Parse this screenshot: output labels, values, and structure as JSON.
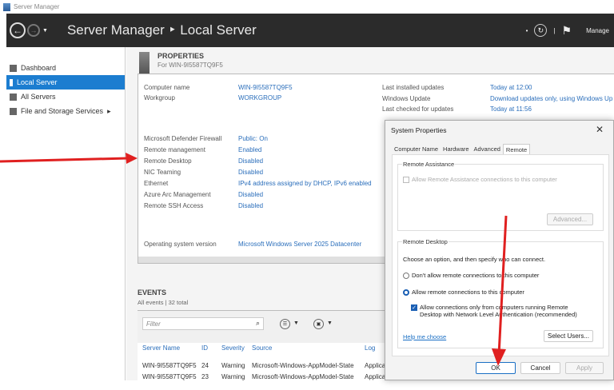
{
  "window": {
    "title": "Server Manager"
  },
  "header": {
    "breadcrumb": "Server Manager ‣ Local Server",
    "manage": "Manage"
  },
  "sidebar": {
    "items": [
      {
        "label": "Dashboard"
      },
      {
        "label": "Local Server",
        "active": true
      },
      {
        "label": "All Servers"
      },
      {
        "label": "File and Storage Services",
        "chevron": "▸"
      }
    ]
  },
  "properties": {
    "title": "PROPERTIES",
    "subtitle": "For WIN-9I5587TQ9F5",
    "left": [
      {
        "label": "Computer name",
        "value": "WIN-9I5587TQ9F5"
      },
      {
        "label": "Workgroup",
        "value": "WORKGROUP"
      },
      {
        "label": "Microsoft Defender Firewall",
        "value": "Public: On"
      },
      {
        "label": "Remote management",
        "value": "Enabled"
      },
      {
        "label": "Remote Desktop",
        "value": "Disabled"
      },
      {
        "label": "NIC Teaming",
        "value": "Disabled"
      },
      {
        "label": "Ethernet",
        "value": "IPv4 address assigned by DHCP, IPv6 enabled"
      },
      {
        "label": "Azure Arc Management",
        "value": "Disabled"
      },
      {
        "label": "Remote SSH Access",
        "value": "Disabled"
      },
      {
        "label": "Operating system version",
        "value": "Microsoft Windows Server 2025 Datacenter"
      }
    ],
    "right": [
      {
        "label": "Last installed updates",
        "value": "Today at 12:00"
      },
      {
        "label": "Windows Update",
        "value": "Download updates only, using Windows Up"
      },
      {
        "label": "Last checked for updates",
        "value": "Today at 11:56"
      }
    ]
  },
  "events": {
    "title": "EVENTS",
    "subtitle": "All events | 32 total",
    "filter_placeholder": "Filter",
    "columns": [
      "Server Name",
      "ID",
      "Severity",
      "Source",
      "Log"
    ],
    "rows": [
      [
        "WIN-9I5587TQ9F5",
        "24",
        "Warning",
        "Microsoft-Windows-AppModel-State",
        "Applica"
      ],
      [
        "WIN-9I5587TQ9F5",
        "23",
        "Warning",
        "Microsoft-Windows-AppModel-State",
        "Applica"
      ]
    ]
  },
  "dialog": {
    "title": "System Properties",
    "close": "✕",
    "tabs": [
      "Computer Name",
      "Hardware",
      "Advanced",
      "Remote"
    ],
    "remote_assistance": {
      "group": "Remote Assistance",
      "checkbox": "Allow Remote Assistance connections to this computer",
      "advanced": "Advanced..."
    },
    "remote_desktop": {
      "group": "Remote Desktop",
      "intro": "Choose an option, and then specify who can connect.",
      "option_off": "Don't allow remote connections to this computer",
      "option_on": "Allow remote connections to this computer",
      "nla_line1": "Allow connections only from computers running Remote",
      "nla_line2": "Desktop with Network Level Authentication (recommended)",
      "help": "Help me choose",
      "select_users": "Select Users..."
    },
    "buttons": {
      "ok": "OK",
      "cancel": "Cancel",
      "apply": "Apply"
    }
  },
  "colors": {
    "accent": "#1c7dd0",
    "header": "#2b2b2b",
    "link": "#2a6ebb",
    "annotation": "#e02020"
  }
}
